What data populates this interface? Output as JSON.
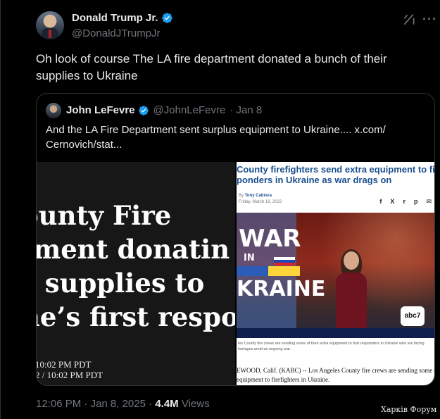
{
  "tweet": {
    "author_name": "Donald Trump Jr.",
    "handle": "@DonaldJTrumpJr",
    "text": "Oh look of course The LA fire department donated a bunch of their supplies to Ukraine",
    "time": "12:06 PM",
    "sep1": "·",
    "date": "Jan 8, 2025",
    "sep2": "·",
    "views_count": "4.4M",
    "views_label": "Views",
    "more_icon": "···"
  },
  "quote": {
    "author_name": "John LeFevre",
    "handle": "@JohnLeFevre",
    "date": "· Jan 8",
    "text": "And the LA Fire Department sent surplus equipment to Ukraine....  x.com/ Cernovich/stat..."
  },
  "media_left": {
    "lines": [
      "ounty Fire",
      "tment donatin",
      "s supplies to",
      "ne’s first respo"
    ],
    "timestamps": [
      "10:02 PM PDT",
      "2 / 10:02 PM PDT"
    ]
  },
  "media_right": {
    "headline_1": "County firefighters send extra equipment to firs",
    "headline_2": "ponders in Ukraine as war drags on",
    "by_prefix": "By",
    "author": "Tony Cabrera",
    "date": "Friday, March 18, 2022",
    "share_icons": [
      "f",
      "X",
      "r",
      "p",
      "✉"
    ],
    "graphic_war": "WAR",
    "graphic_in": "IN",
    "graphic_kraine": "KRAINE",
    "logo": "abc7",
    "caption": "les County fire crews are sending some of their extra equipment to first responders in Ukraine who are facing hortages amid an ongoing war.",
    "body_1": "EWOOD, Calif. (KABC) -- Los Angeles County fire crews are sending some of th",
    "body_2": "equipment to firefighters in Ukraine."
  },
  "watermark": "Харків Форум",
  "colors": {
    "background": "#000000",
    "text": "#e7e9ea",
    "muted": "#71767b",
    "verified": "#1d9bf0",
    "border": "#2f3336"
  }
}
